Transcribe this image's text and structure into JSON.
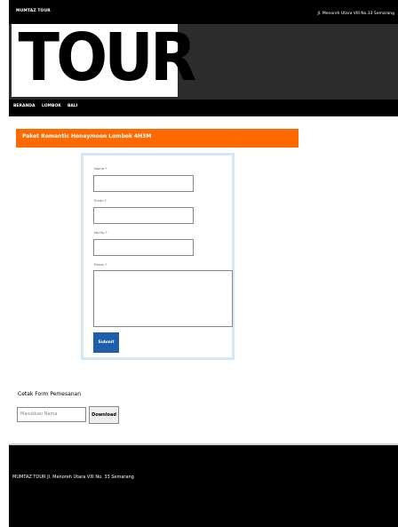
{
  "top_bar": {
    "brand": "MUMTAZ TOUR",
    "address": "Jl. Menoreh Utara VIII No.33 Semarang"
  },
  "logo": {
    "text": "TOUR"
  },
  "nav": {
    "items": [
      {
        "label": "BERANDA"
      },
      {
        "label": "LOMBOK"
      },
      {
        "label": "BALI"
      }
    ]
  },
  "page_title": "Paket Romantic Honeymoon Lombok 4H3M",
  "form": {
    "fields": [
      {
        "label": "Nama *"
      },
      {
        "label": "Email *"
      },
      {
        "label": "No.Hp *"
      },
      {
        "label": "Pesan *"
      }
    ],
    "submit_label": "Submit"
  },
  "print_form": {
    "title": "Cetak Form Pemesanan",
    "input_placeholder": "Masukkan Nama",
    "download_label": "Download"
  },
  "footer": {
    "text": "MUMTAZ TOUR Jl. Menoreh Utara VIII No. 33 Semarang"
  },
  "colors": {
    "accent": "#ff6a00",
    "button": "#1f5ea8",
    "header_bg": "#2c2c2c",
    "bar_bg": "#000000"
  }
}
